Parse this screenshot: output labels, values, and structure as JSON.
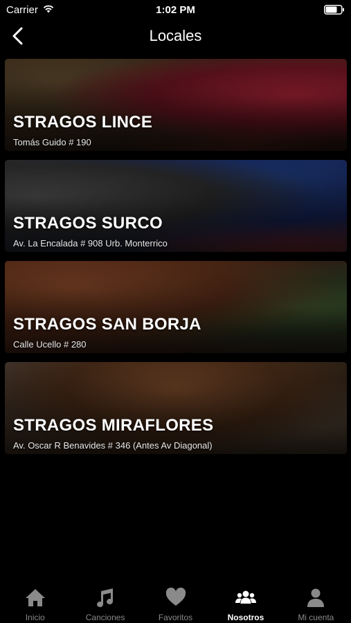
{
  "status_bar": {
    "carrier": "Carrier",
    "time": "1:02 PM"
  },
  "nav": {
    "title": "Locales",
    "back_icon": "chevron-left-icon"
  },
  "locations": [
    {
      "name": "STRAGOS LINCE",
      "address": "Tomás Guido # 190"
    },
    {
      "name": "STRAGOS SURCO",
      "address": "Av. La Encalada # 908 Urb. Monterrico"
    },
    {
      "name": "STRAGOS SAN BORJA",
      "address": "Calle Ucello # 280"
    },
    {
      "name": "STRAGOS MIRAFLORES",
      "address": "Av. Oscar R Benavides # 346 (Antes Av Diagonal)"
    }
  ],
  "tabs": [
    {
      "label": "Inicio",
      "icon": "home-icon"
    },
    {
      "label": "Canciones",
      "icon": "music-note-icon"
    },
    {
      "label": "Favoritos",
      "icon": "heart-icon"
    },
    {
      "label": "Nosotros",
      "icon": "group-icon",
      "active": true
    },
    {
      "label": "Mi cuenta",
      "icon": "user-icon"
    }
  ],
  "colors": {
    "background": "#000000",
    "tab_inactive": "#8a8a8a",
    "tab_active": "#ffffff"
  }
}
